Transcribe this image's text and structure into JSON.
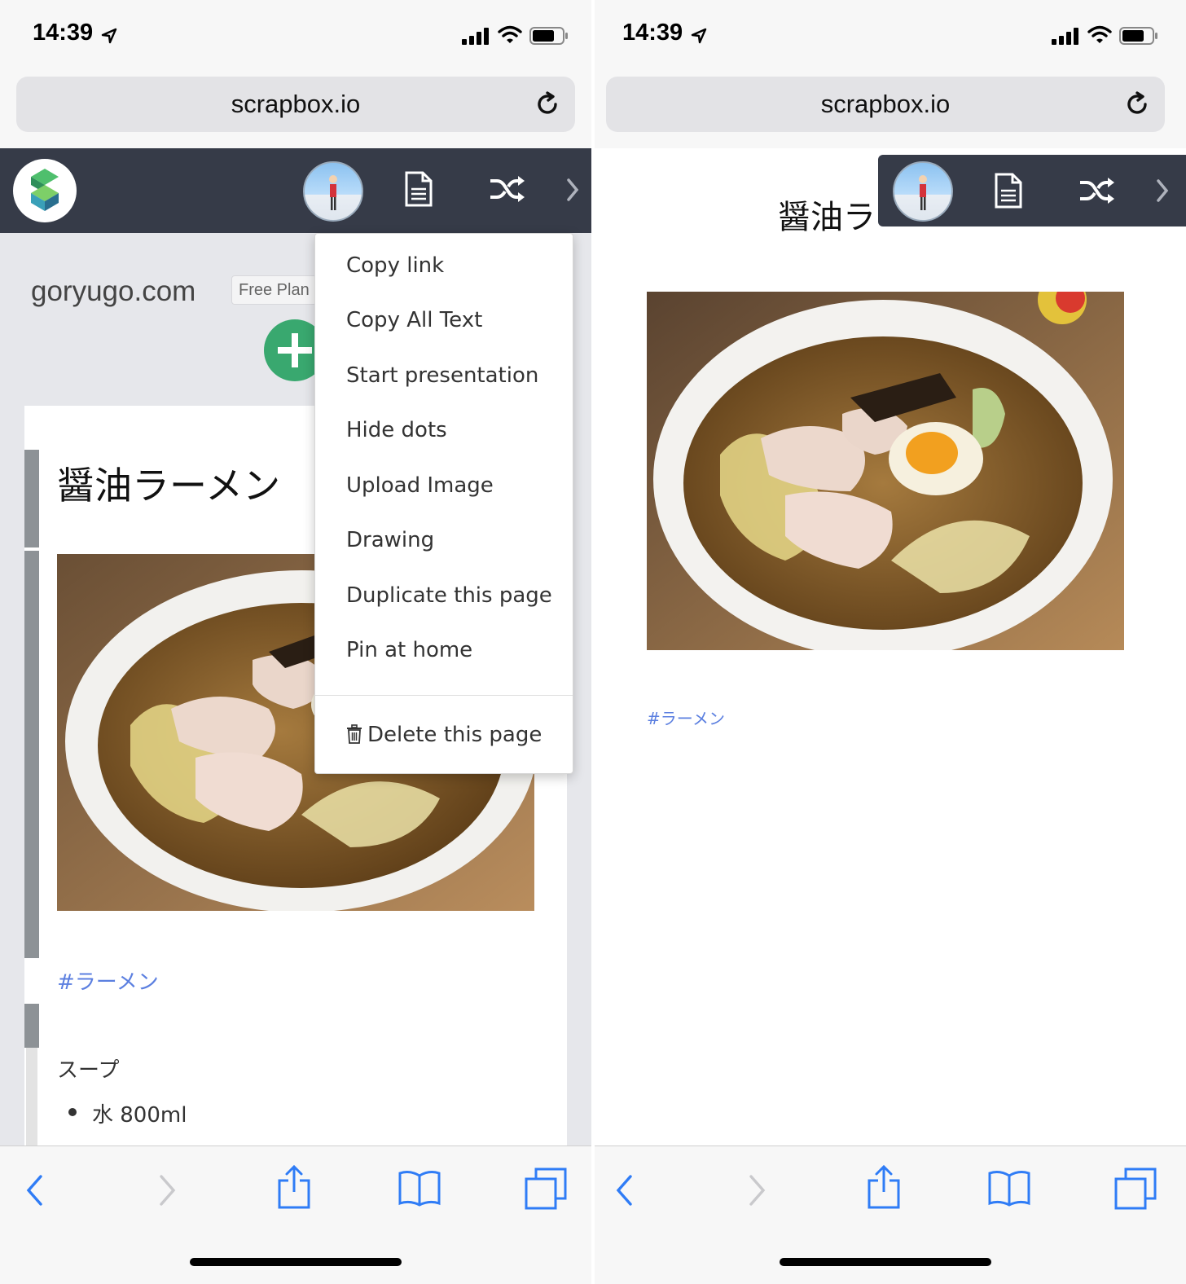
{
  "left": {
    "status": {
      "time": "14:39"
    },
    "url": "scrapbox.io",
    "project_name": "goryugo.com",
    "plan_badge": "Free Plan",
    "page_title": "醤油ラーメン",
    "tag": "#ラーメン",
    "lines": {
      "soup": "スープ",
      "water": "水 800ml"
    },
    "menu": {
      "items": [
        "Copy link",
        "Copy All Text",
        "Start presentation",
        "Hide dots",
        "Upload Image",
        "Drawing",
        "Duplicate this page",
        "Pin at home"
      ],
      "delete_label": "Delete this page"
    }
  },
  "right": {
    "status": {
      "time": "14:39"
    },
    "url": "scrapbox.io",
    "page_title_visible": "醤油ラ",
    "tag": "#ラーメン"
  },
  "colors": {
    "header_bg": "#363b48",
    "tag_link": "#5b7fe0",
    "add_button": "#39a86f",
    "ios_blue": "#2f7cf6"
  },
  "icons": [
    "location-arrow-icon",
    "signal-icon",
    "wifi-icon",
    "battery-icon",
    "reload-icon",
    "scrapbox-logo-icon",
    "page-icon",
    "shuffle-icon",
    "chevron-right-icon",
    "trash-icon",
    "back-icon",
    "forward-icon",
    "share-icon",
    "bookmarks-icon",
    "tabs-icon"
  ]
}
